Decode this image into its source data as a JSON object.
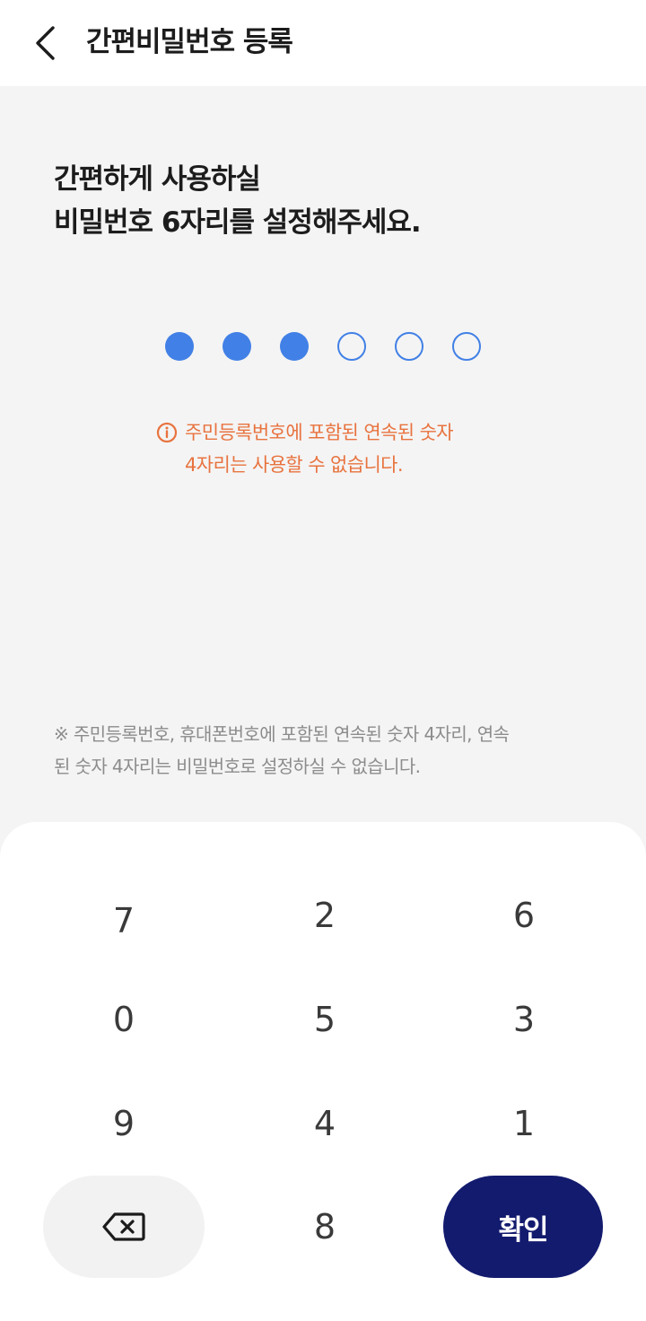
{
  "header": {
    "title": "간편비밀번호 등록",
    "back_icon": "chevron-left-icon"
  },
  "headline": {
    "line1": "간편하게 사용하실",
    "line2": "비밀번호 6자리를 설정해주세요."
  },
  "pin": {
    "length": 6,
    "entered": 3,
    "accent_color": "#4180e6"
  },
  "error": {
    "icon": "info-circle-icon",
    "line1": "주민등록번호에 포함된 연속된 숫자",
    "line2": "4자리는 사용할 수 없습니다.",
    "color": "#e8733f"
  },
  "notice": {
    "line1": "※ 주민등록번호, 휴대폰번호에 포함된 연속된 숫자 4자리, 연속",
    "line2": "된 숫자 4자리는 비밀번호로 설정하실 수 없습니다."
  },
  "keypad": {
    "rows": [
      [
        "7",
        "2",
        "6"
      ],
      [
        "0",
        "5",
        "3"
      ],
      [
        "9",
        "4",
        "1"
      ]
    ],
    "bottom_digit": "8",
    "backspace_icon": "backspace-icon",
    "confirm_label": "확인",
    "confirm_color": "#131b6e"
  }
}
